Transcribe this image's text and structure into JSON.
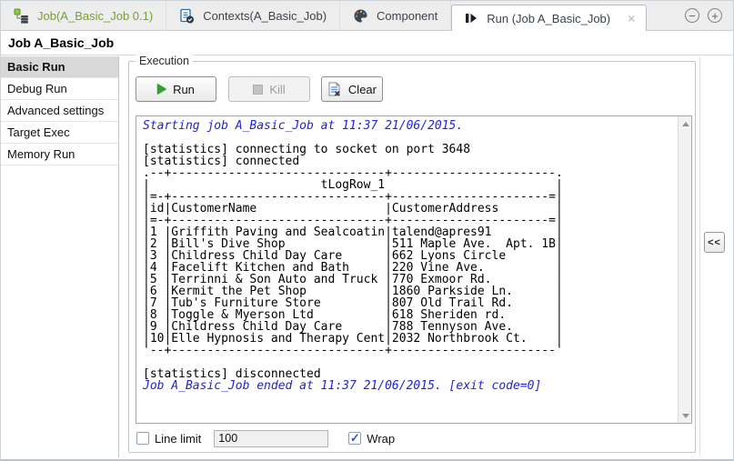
{
  "tabs": [
    {
      "id": "job",
      "label": "Job(A_Basic_Job 0.1)",
      "icon": "job-icon",
      "label_color": "#74a32c",
      "active": false,
      "closable": false
    },
    {
      "id": "contexts",
      "label": "Contexts(A_Basic_Job)",
      "icon": "contexts-icon",
      "label_color": "",
      "active": false,
      "closable": false
    },
    {
      "id": "component",
      "label": "Component",
      "icon": "component-icon",
      "label_color": "",
      "active": false,
      "closable": false
    },
    {
      "id": "run",
      "label": "Run (Job A_Basic_Job)",
      "icon": "run-icon",
      "label_color": "",
      "active": true,
      "closable": true
    }
  ],
  "window_controls": {
    "minimize": "−",
    "maximize": "+"
  },
  "page_title": "Job A_Basic_Job",
  "sidebar": {
    "items": [
      {
        "label": "Basic Run",
        "selected": true
      },
      {
        "label": "Debug Run",
        "selected": false
      },
      {
        "label": "Advanced settings",
        "selected": false
      },
      {
        "label": "Target Exec",
        "selected": false
      },
      {
        "label": "Memory Run",
        "selected": false
      }
    ]
  },
  "execution": {
    "group_label": "Execution",
    "buttons": {
      "run": "Run",
      "kill": "Kill",
      "clear": "Clear"
    },
    "console_lines": [
      {
        "style": "info",
        "text": "Starting job A_Basic_Job at 11:37 21/06/2015."
      },
      {
        "style": "plain",
        "text": ""
      },
      {
        "style": "plain",
        "text": "[statistics] connecting to socket on port 3648"
      },
      {
        "style": "plain",
        "text": "[statistics] connected"
      },
      {
        "style": "plain",
        "text": ".--+------------------------------+-----------------------."
      },
      {
        "style": "plain",
        "text": "|                        tLogRow_1                        |"
      },
      {
        "style": "plain",
        "text": "|=-+------------------------------+----------------------=|"
      },
      {
        "style": "plain",
        "text": "|id|CustomerName                  |CustomerAddress        |"
      },
      {
        "style": "plain",
        "text": "|=-+------------------------------+----------------------=|"
      },
      {
        "style": "plain",
        "text": "|1 |Griffith Paving and Sealcoatin|talend@apres91         |"
      },
      {
        "style": "plain",
        "text": "|2 |Bill's Dive Shop              |511 Maple Ave.  Apt. 1B|"
      },
      {
        "style": "plain",
        "text": "|3 |Childress Child Day Care      |662 Lyons Circle       |"
      },
      {
        "style": "plain",
        "text": "|4 |Facelift Kitchen and Bath     |220 Vine Ave.          |"
      },
      {
        "style": "plain",
        "text": "|5 |Terrinni & Son Auto and Truck |770 Exmoor Rd.         |"
      },
      {
        "style": "plain",
        "text": "|6 |Kermit the Pet Shop           |1860 Parkside Ln.      |"
      },
      {
        "style": "plain",
        "text": "|7 |Tub's Furniture Store         |807 Old Trail Rd.      |"
      },
      {
        "style": "plain",
        "text": "|8 |Toggle & Myerson Ltd          |618 Sheriden rd.       |"
      },
      {
        "style": "plain",
        "text": "|9 |Childress Child Day Care      |788 Tennyson Ave.      |"
      },
      {
        "style": "plain",
        "text": "|10|Elle Hypnosis and Therapy Cent|2032 Northbrook Ct.    |"
      },
      {
        "style": "plain",
        "text": "'--+------------------------------+-----------------------'"
      },
      {
        "style": "plain",
        "text": ""
      },
      {
        "style": "plain",
        "text": "[statistics] disconnected"
      },
      {
        "style": "info",
        "text": "Job A_Basic_Job ended at 11:37 21/06/2015. [exit code=0]"
      }
    ],
    "line_limit": {
      "label": "Line limit",
      "checked": false,
      "value": "100"
    },
    "wrap": {
      "label": "Wrap",
      "checked": true
    },
    "collapse_label": "<<"
  },
  "colors": {
    "job_tab_text": "#74a32c",
    "console_info_blue": "#2323cd",
    "run_icon_green": "#33a02c",
    "checkbox_check_blue": "#2f5bc7",
    "sidebar_selected_bg": "#d8d8d8"
  }
}
